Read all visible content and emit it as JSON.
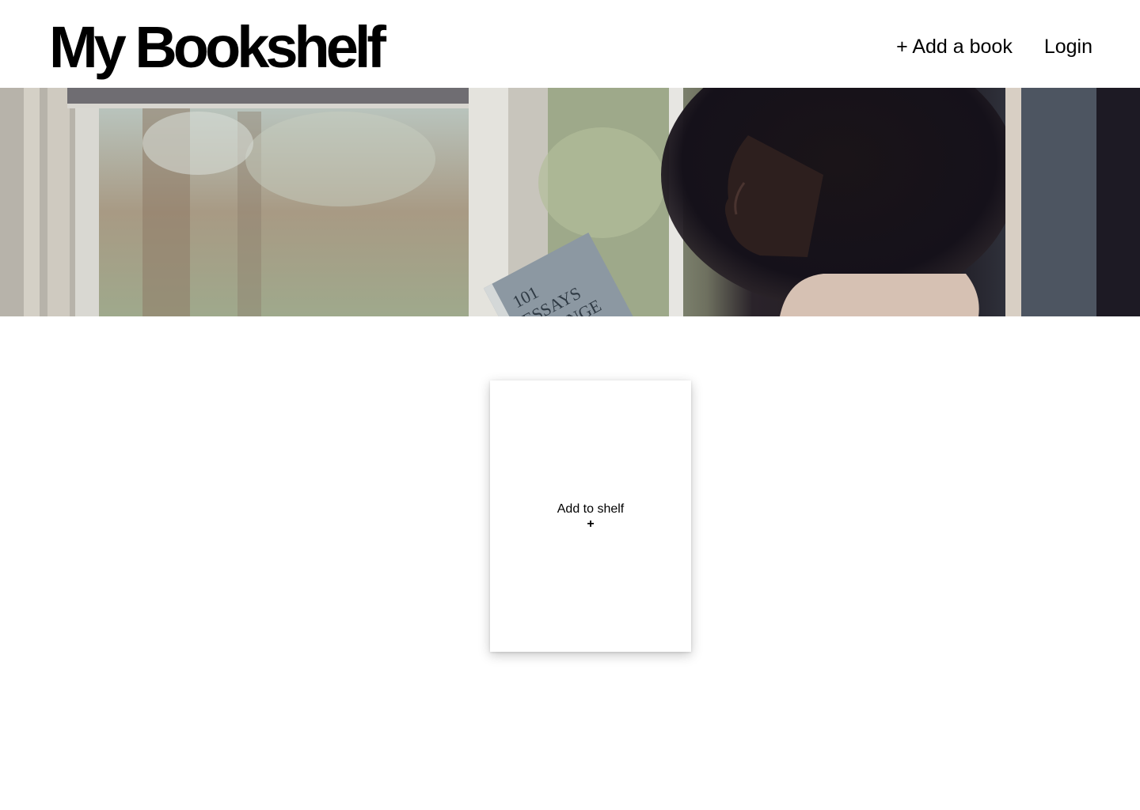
{
  "header": {
    "title": "My Bookshelf",
    "nav": {
      "add_book": "+ Add a book",
      "login": "Login"
    }
  },
  "hero": {
    "image": "woman-reading-by-window",
    "book_cover_text": [
      "101",
      "ESSAYS",
      "NGE"
    ]
  },
  "shelf": {
    "add_card": {
      "label": "Add to shelf",
      "icon": "+"
    }
  }
}
